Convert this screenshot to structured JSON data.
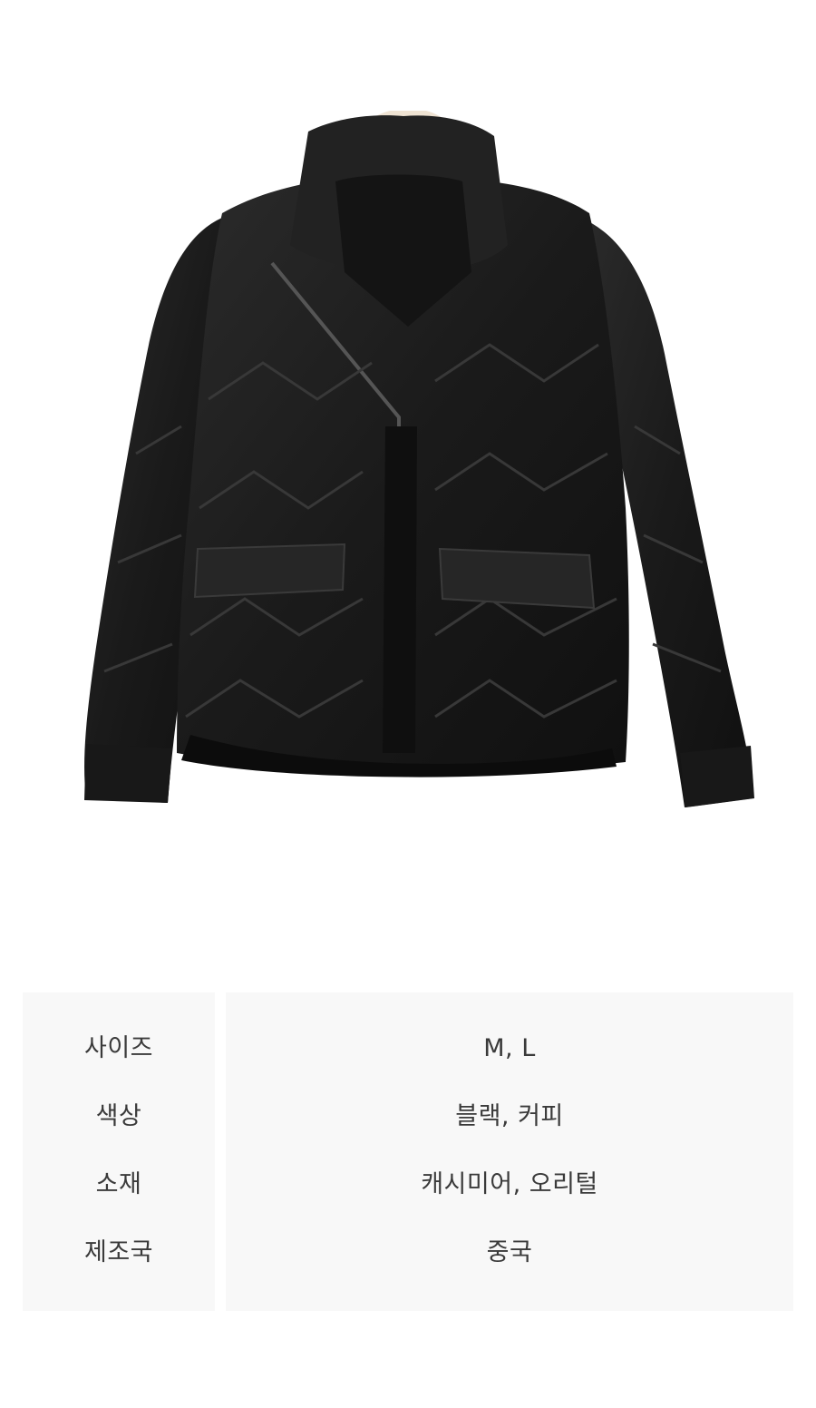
{
  "product_image": {
    "icon": "black-quilted-down-jacket-on-hanger-photo"
  },
  "spec_table": {
    "rows": [
      {
        "label": "사이즈",
        "value": "M, L"
      },
      {
        "label": "색상",
        "value": "블랙, 커피"
      },
      {
        "label": "소재",
        "value": "캐시미어, 오리털"
      },
      {
        "label": "제조국",
        "value": "중국"
      }
    ]
  },
  "colors": {
    "table_background": "#f8f8f8",
    "text": "#3a3a3a",
    "jacket": "#1c1c1c"
  }
}
